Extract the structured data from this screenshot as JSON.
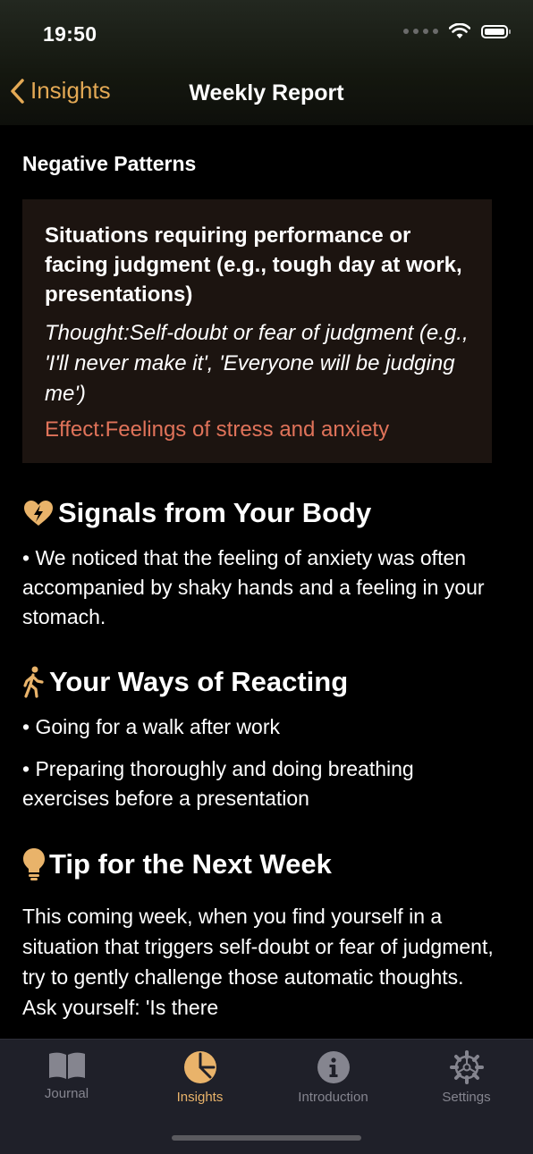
{
  "status": {
    "time": "19:50"
  },
  "nav": {
    "back_label": "Insights",
    "title": "Weekly Report"
  },
  "negative_patterns": {
    "label": "Negative Patterns",
    "card": {
      "situation": "Situations requiring performance or facing judgment (e.g., tough day at work, presentations)",
      "thought": "Thought:Self-doubt or fear of judgment (e.g., 'I'll never make it', 'Everyone will be judging me')",
      "effect": "Effect:Feelings of stress and anxiety"
    }
  },
  "body_signals": {
    "title": "Signals from Your Body",
    "icon": "heart-bolt-icon",
    "items": [
      "• We noticed that the feeling of anxiety was often accompanied by shaky hands and a feeling in your stomach."
    ]
  },
  "reactions": {
    "title": "Your Ways of Reacting",
    "icon": "walking-figure-icon",
    "items": [
      "• Going for a walk after work",
      "• Preparing thoroughly and doing breathing exercises before a presentation"
    ]
  },
  "tip": {
    "title": "Tip for the Next Week",
    "icon": "lightbulb-icon",
    "text": "This coming week, when you find yourself in a situation that triggers self-doubt or fear of judgment, try to gently challenge those automatic thoughts. Ask yourself: 'Is there"
  },
  "tabs": [
    {
      "label": "Journal",
      "icon": "book-icon",
      "active": false
    },
    {
      "label": "Insights",
      "icon": "pie-chart-icon",
      "active": true
    },
    {
      "label": "Introduction",
      "icon": "info-icon",
      "active": false
    },
    {
      "label": "Settings",
      "icon": "gear-icon",
      "active": false
    }
  ],
  "colors": {
    "accent": "#e3a955",
    "effect": "#e0735a",
    "card_bg": "#1c1410",
    "tabbar_bg": "#1f2029"
  }
}
